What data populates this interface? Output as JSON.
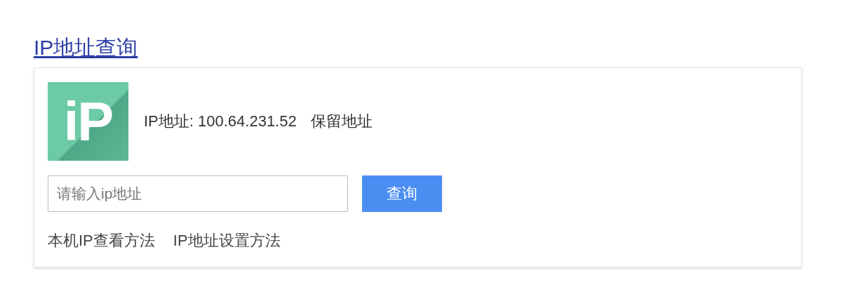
{
  "title_link": "IP地址查询",
  "logo": {
    "text": "iP"
  },
  "ip_info": {
    "label": "IP地址: 100.64.231.52",
    "type": "保留地址"
  },
  "search": {
    "placeholder": "请输入ip地址",
    "button": "查询"
  },
  "links": [
    "本机IP查看方法",
    "IP地址设置方法"
  ]
}
